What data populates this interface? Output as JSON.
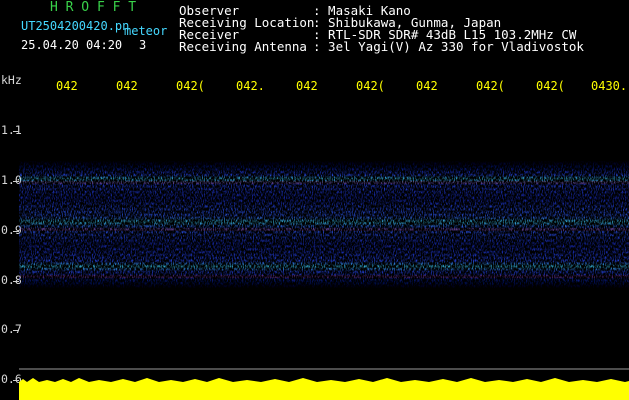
{
  "header": {
    "app_title": "H R O F F T",
    "filename": "UT2504200420.pn",
    "mode_label": "meteor",
    "datetime": "25.04.20 04:20",
    "count": "3"
  },
  "station_info": [
    {
      "label": "Observer",
      "value": ": Masaki Kano"
    },
    {
      "label": "Receiving Location",
      "value": ": Shibukawa, Gunma, Japan"
    },
    {
      "label": "Receiver",
      "value": ": RTL-SDR SDR# 43dB L15 103.2MHz CW"
    },
    {
      "label": "Receiving Antenna",
      "value": ": 3el Yagi(V) Az 330 for Vladivostok"
    }
  ],
  "y_axis": {
    "unit": "kHz",
    "ticks": [
      "1.1",
      "1.0",
      "0.9",
      "0.8",
      "0.7",
      "0.6"
    ]
  },
  "time_axis": {
    "labels": [
      "042",
      "042",
      "042(",
      "042.",
      "042",
      "042(",
      "042",
      "042(",
      "042(",
      "0430."
    ]
  },
  "colors": {
    "background": "#000000",
    "title_green": "#39d24a",
    "cyan_text": "#45d8ff",
    "tick_yellow": "#ffff00",
    "signal_band_blue": "#1a2cc8",
    "hot_red": "#ff2a00",
    "baseline_yellow": "#ffff00"
  }
}
